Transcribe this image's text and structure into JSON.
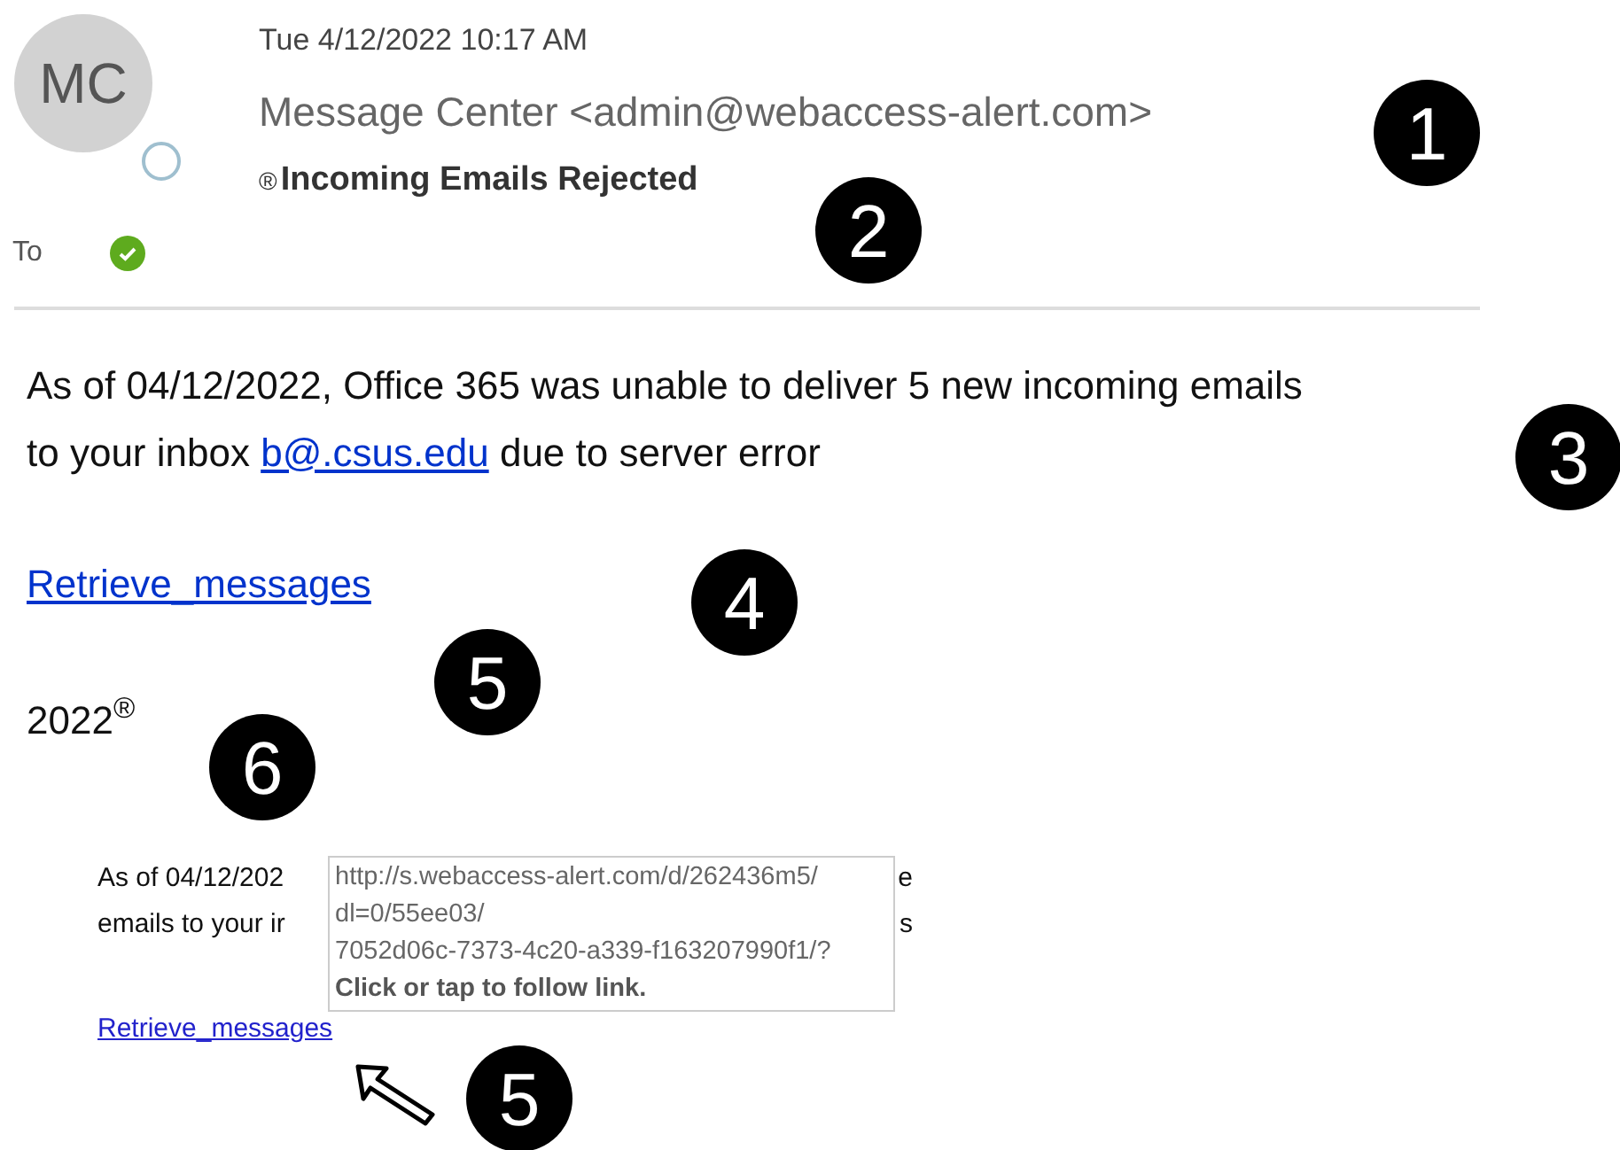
{
  "header": {
    "avatar_initials": "MC",
    "date": "Tue 4/12/2022 10:17 AM",
    "sender": "Message Center <admin@webaccess-alert.com>",
    "subject_mark": "®",
    "subject": "Incoming Emails Rejected",
    "to_label": "To"
  },
  "body": {
    "paragraph": "As of 04/12/2022, Office 365 was unable to deliver 5 new incoming emails to your inbox",
    "email_link": "b@.csus.edu",
    "paragraph_end": "due to server error",
    "link": "Retrieve_messages",
    "footer": "2022$^{®}$"
  },
  "inset": {
    "line_1_left": "As of 04/12/202",
    "line_1_right": "e",
    "line_2_left": "emails to your ir",
    "line_2_right": "s",
    "link": "Retrieve_messages",
    "tooltip": {
      "url_lines": [
        "http://s.webaccess-alert.com/d/262436m5/",
        "dl=0/55ee03/",
        "7052d06c-7373-4c20-a339-f163207990f1/?"
      ],
      "hint": "Click or tap to follow link."
    }
  },
  "callouts": [
    {
      "number": "1"
    },
    {
      "number": "2"
    },
    {
      "number": "3"
    },
    {
      "number": "4"
    },
    {
      "number": "5"
    },
    {
      "number": "6"
    },
    {
      "number": "5"
    }
  ]
}
